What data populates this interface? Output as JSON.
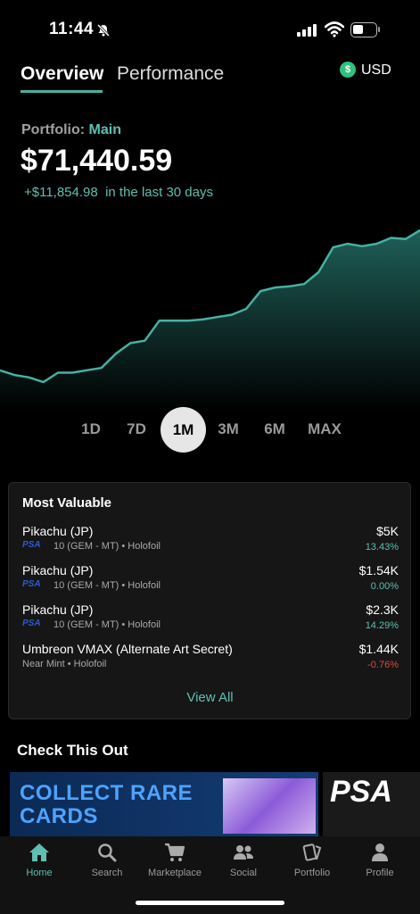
{
  "status": {
    "time": "11:44"
  },
  "header": {
    "tabs": [
      {
        "label": "Overview"
      },
      {
        "label": "Performance"
      }
    ],
    "currency": {
      "symbol": "$",
      "label": "USD"
    }
  },
  "portfolio": {
    "label": "Portfolio:",
    "name": "Main",
    "value": "$71,440.59",
    "change": "+$11,854.98",
    "change_period": "in the last 30 days"
  },
  "chart_data": {
    "type": "area",
    "x": [
      0,
      1,
      2,
      3,
      4,
      5,
      6,
      7,
      8,
      9,
      10,
      11,
      12,
      13,
      14,
      15,
      16,
      17,
      18,
      19,
      20,
      21,
      22,
      23,
      24,
      25,
      26,
      27,
      28,
      29
    ],
    "values": [
      59586,
      59200,
      59000,
      58600,
      59400,
      59400,
      59600,
      59800,
      61000,
      61900,
      62100,
      63800,
      63800,
      63800,
      63900,
      64100,
      64300,
      64800,
      66300,
      66600,
      66700,
      66900,
      67900,
      70000,
      70300,
      70100,
      70300,
      70800,
      70700,
      71440
    ],
    "colors": {
      "line": "#46b1a2",
      "fill_top": "#1f5f58",
      "fill_bottom": "#000000"
    }
  },
  "ranges": [
    {
      "label": "1D",
      "selected": false
    },
    {
      "label": "7D",
      "selected": false
    },
    {
      "label": "1M",
      "selected": true
    },
    {
      "label": "3M",
      "selected": false
    },
    {
      "label": "6M",
      "selected": false
    },
    {
      "label": "MAX",
      "selected": false
    }
  ],
  "most_valuable": {
    "title": "Most Valuable",
    "items": [
      {
        "name": "Pikachu (JP)",
        "grader": "PSA",
        "detail": "10 (GEM - MT) • Holofoil",
        "price": "$5K",
        "pct": "13.43%",
        "pct_color": "#5fbfb0"
      },
      {
        "name": "Pikachu (JP)",
        "grader": "PSA",
        "detail": "10 (GEM - MT) • Holofoil",
        "price": "$1.54K",
        "pct": "0.00%",
        "pct_color": "#5fbfb0"
      },
      {
        "name": "Pikachu (JP)",
        "grader": "PSA",
        "detail": "10 (GEM - MT) • Holofoil",
        "price": "$2.3K",
        "pct": "14.29%",
        "pct_color": "#5fbfb0"
      },
      {
        "name": "Umbreon VMAX (Alternate Art Secret)",
        "grader": "",
        "detail": "Near Mint • Holofoil",
        "price": "$1.44K",
        "pct": "-0.76%",
        "pct_color": "#e0483d"
      }
    ],
    "view_all": "View All"
  },
  "promo": {
    "title": "Check This Out",
    "banner_line1": "COLLECT RARE",
    "banner_line2": "CARDS",
    "banner2": "PSA"
  },
  "nav": [
    {
      "label": "Home",
      "icon": "home-icon",
      "active": true
    },
    {
      "label": "Search",
      "icon": "search-icon",
      "active": false
    },
    {
      "label": "Marketplace",
      "icon": "cart-icon",
      "active": false
    },
    {
      "label": "Social",
      "icon": "people-icon",
      "active": false
    },
    {
      "label": "Portfolio",
      "icon": "cards-icon",
      "active": false
    },
    {
      "label": "Profile",
      "icon": "person-icon",
      "active": false
    }
  ]
}
